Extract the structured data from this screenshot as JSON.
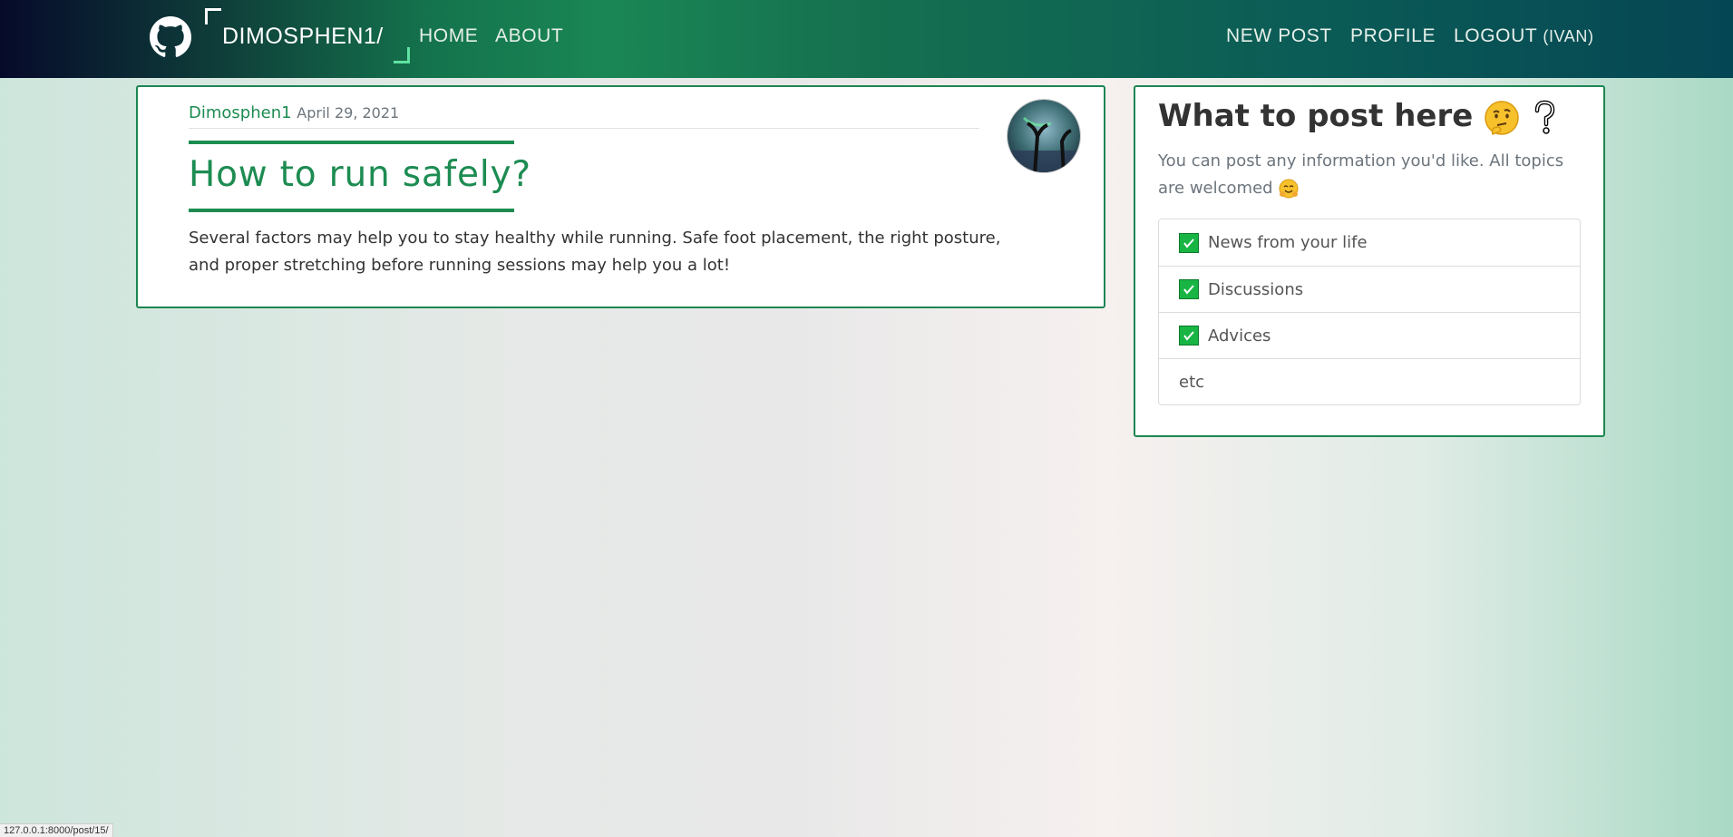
{
  "navbar": {
    "brand": "DIMOSPHEN1/",
    "links": {
      "home": "HOME",
      "about": "ABOUT",
      "new_post": "NEW POST",
      "profile": "PROFILE",
      "logout": "LOGOUT",
      "logout_user": "(IVAN)"
    },
    "icons": {
      "logo": "github-icon"
    }
  },
  "post": {
    "author": "Dimosphen1",
    "date": "April 29, 2021",
    "title": "How to run safely?",
    "body": "Several factors may help you to stay healthy while running. Safe foot placement, the right posture, and proper stretching before running sessions may help you a lot!",
    "avatar_icon": "user-avatar-image"
  },
  "sidebar": {
    "title": "What to post here",
    "title_icons": [
      "thinking-face-emoji-icon",
      "question-mark-icon"
    ],
    "text": "You can post any information you'd like. All topics are welcomed",
    "text_icon": "hugging-face-emoji-icon",
    "items": [
      {
        "label": "News from your life",
        "icon": "check-mark-icon"
      },
      {
        "label": "Discussions",
        "icon": "check-mark-icon"
      },
      {
        "label": "Advices",
        "icon": "check-mark-icon"
      },
      {
        "label": "etc",
        "icon": ""
      }
    ]
  },
  "status_bar": {
    "url": "127.0.0.1:8000/post/15/"
  },
  "colors": {
    "accent_green": "#1d8c52",
    "check_green": "#18b544",
    "navbar_dark": "#060a2a"
  }
}
